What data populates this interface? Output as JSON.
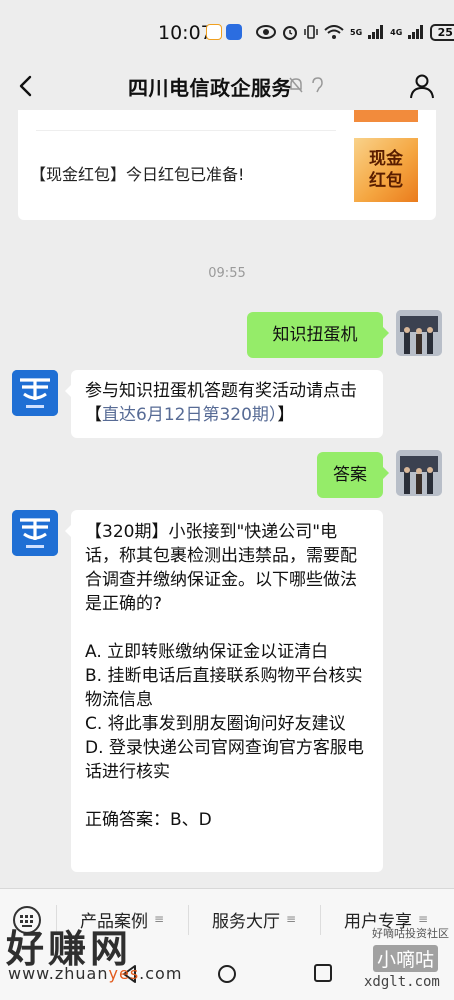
{
  "status_bar": {
    "time": "10:07",
    "signal_1": "5G",
    "signal_2": "4G",
    "battery": "25"
  },
  "header": {
    "title": "四川电信政企服务"
  },
  "card": {
    "text": "【现金红包】今日红包已准备!",
    "thumb_line1": "现金",
    "thumb_line2": "红包"
  },
  "timestamp": "09:55",
  "messages": {
    "user_1": "知识扭蛋机",
    "bot_1_text": "参与知识扭蛋机答题有奖活动请点击【",
    "bot_1_link": "直达6月12日第320期）",
    "bot_1_suffix": "】",
    "user_2": "答案",
    "bot_2": {
      "question": "【320期】小张接到\"快递公司\"电话，称其包裹检测出违禁品，需要配合调查并缴纳保证金。以下哪些做法是正确的?",
      "option_a": "A. 立即转账缴纳保证金以证清白",
      "option_b": "B. 挂断电话后直接联系购物平台核实物流信息",
      "option_c": "C. 将此事发到朋友圈询问好友建议",
      "option_d": "D. 登录快递公司官网查询官方客服电话进行核实",
      "answer": "正确答案：B、D"
    }
  },
  "bottom_menu": {
    "item_1": "产品案例",
    "item_2": "服务大厅",
    "item_3": "用户专享"
  },
  "watermark": {
    "logo": "好赚网",
    "url_pre": "www.zhuan",
    "url_hl": "yes",
    "url_post": ".com",
    "right_1": "好嘀咕投资社区",
    "right_2": "小嘀咕",
    "right_3": "xdglt.com"
  },
  "colors": {
    "background": "#ededed",
    "bubble_sent": "#95ec69",
    "bubble_received": "#ffffff",
    "link": "#576b95",
    "bot_avatar": "#1f6fd4"
  }
}
